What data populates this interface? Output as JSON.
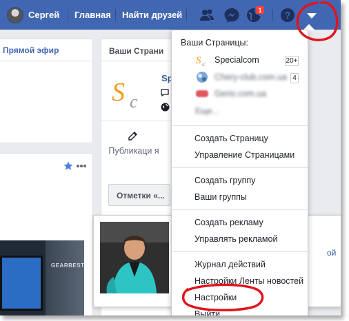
{
  "topbar": {
    "user_name": "Сергей",
    "home_label": "Главная",
    "find_friends_label": "Найти друзей",
    "notifications_count": "1",
    "icons": [
      "friends-icon",
      "messenger-icon",
      "notifications-globe-icon",
      "help-icon",
      "account-menu-arrow-icon"
    ]
  },
  "left": {
    "live_label": "Прямой эфир",
    "thumbnail_text": "GEARBEST"
  },
  "pages_card": {
    "header": "Ваши Страни",
    "page_name_partial": "Sp",
    "publish_label": "Публикаци я",
    "marks_button": "Отметки «..."
  },
  "hover_card": {
    "link_partial": "ой"
  },
  "dropdown": {
    "section_title": "Ваши Страницы:",
    "pages": [
      {
        "name": "Specialcom",
        "badge": "20+",
        "blurred": false
      },
      {
        "name": "Chery-club.com.ua",
        "badge": "4",
        "blurred": true
      },
      {
        "name": "Gerio.com.ua",
        "badge": "",
        "blurred": true
      }
    ],
    "more_label": "Еще...",
    "create_page": "Создать Страницу",
    "manage_pages": "Управление Страницами",
    "create_group": "Создать группу",
    "your_groups": "Ваши группы",
    "create_ad": "Создать рекламу",
    "manage_ads": "Управлять рекламой",
    "activity_log": "Журнал действий",
    "news_feed_settings": "Настройки Ленты новостей",
    "settings": "Настройки",
    "logout": "Выйти"
  },
  "colors": {
    "topbar": "#4267b2",
    "link": "#365899",
    "badge_red": "#fa3e3e",
    "annotation_red": "#e0141e"
  }
}
